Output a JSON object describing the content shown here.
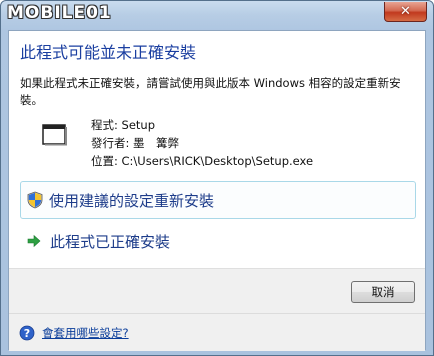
{
  "window": {
    "watermark": "MOBILE01",
    "close_glyph": "✕"
  },
  "dialog": {
    "heading": "此程式可能並未正確安裝",
    "description": "如果此程式未正確安裝，請嘗試使用與此版本 Windows 相容的設定重新安裝。",
    "program_line": "程式: Setup",
    "publisher_line": "發行者: 墨　篝弊",
    "location_line": "位置: C:\\Users\\RICK\\Desktop\\Setup.exe"
  },
  "commands": {
    "reinstall_label": "使用建議的設定重新安裝",
    "installed_label": "此程式已正確安裝"
  },
  "footer": {
    "cancel_label": "取消",
    "help_link": "會套用哪些設定?"
  },
  "colors": {
    "heading": "#1a3ea0",
    "command_text": "#1d3c8a",
    "shield_blue": "#2f6fd6",
    "shield_yellow": "#f4c430",
    "arrow_green": "#2ea043",
    "close_red": "#c1391e"
  },
  "icons": {
    "program": "program-window-icon",
    "shield": "uac-shield-icon",
    "arrow": "green-arrow-icon",
    "help": "help-question-icon",
    "close": "close-icon"
  }
}
